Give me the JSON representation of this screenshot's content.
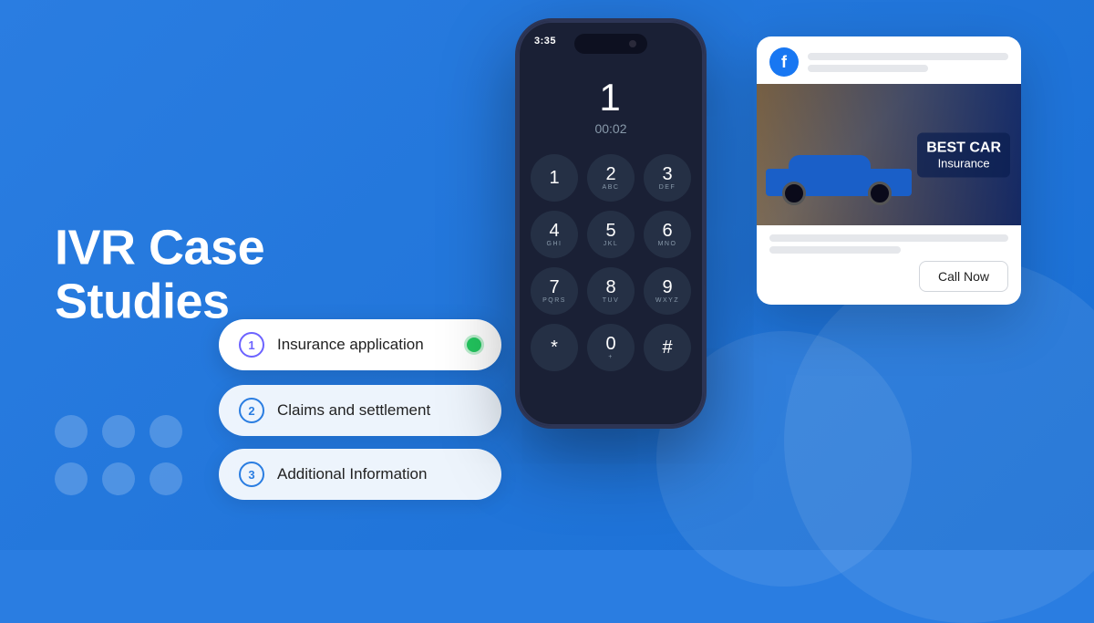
{
  "page": {
    "title": "IVR Case Studies",
    "background_color": "#2a7de1"
  },
  "hero": {
    "title_line1": "IVR Case",
    "title_line2": "Studies"
  },
  "menu_items": [
    {
      "number": "1",
      "label": "Insurance application",
      "active": true,
      "show_indicator": true
    },
    {
      "number": "2",
      "label": "Claims and settlement",
      "active": false,
      "show_indicator": false
    },
    {
      "number": "3",
      "label": "Additional Information",
      "active": false,
      "show_indicator": false
    }
  ],
  "phone": {
    "status_time": "3:35",
    "call_number": "1",
    "call_timer": "00:02",
    "dial_keys": [
      {
        "main": "1",
        "sub": ""
      },
      {
        "main": "2",
        "sub": "ABC"
      },
      {
        "main": "3",
        "sub": "DEF"
      },
      {
        "main": "4",
        "sub": "GHI"
      },
      {
        "main": "5",
        "sub": "JKL"
      },
      {
        "main": "6",
        "sub": "MNO"
      },
      {
        "main": "7",
        "sub": "PQRS"
      },
      {
        "main": "8",
        "sub": "TUV"
      },
      {
        "main": "9",
        "sub": "WXYZ"
      },
      {
        "main": "*",
        "sub": ""
      },
      {
        "main": "0",
        "sub": "+"
      },
      {
        "main": "#",
        "sub": ""
      }
    ]
  },
  "ad_card": {
    "fb_letter": "f",
    "image_text_line1": "BEST CAR",
    "image_text_line2": "Insurance",
    "call_now_label": "Call Now"
  }
}
